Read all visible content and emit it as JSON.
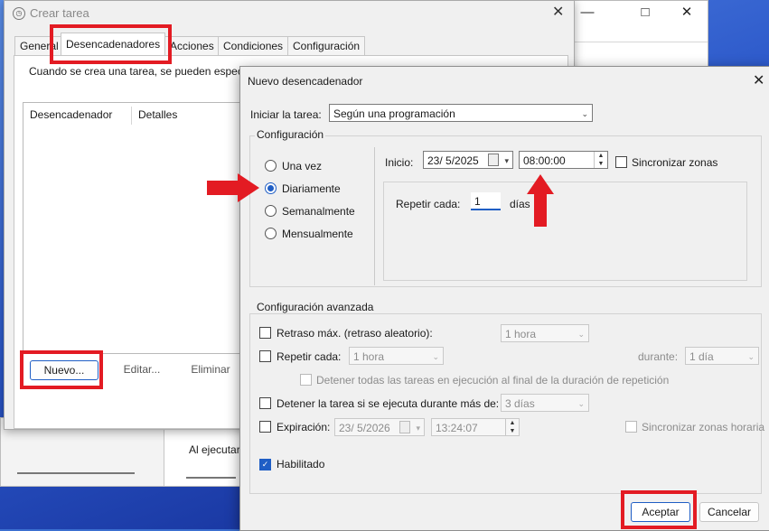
{
  "back_dialog": {
    "title": "Crear tarea",
    "tabs": [
      "General",
      "Desencadenadores",
      "Acciones",
      "Condiciones",
      "Configuración"
    ],
    "description": "Cuando se crea una tarea, se pueden especific",
    "columns": [
      "Desencadenador",
      "Detalles"
    ],
    "buttons": {
      "new": "Nuevo...",
      "edit": "Editar...",
      "delete": "Eliminar"
    },
    "lower_texts": [
      "Al ejecutar"
    ]
  },
  "dialog": {
    "title": "Nuevo desencadenador",
    "start_task_label": "Iniciar la tarea:",
    "start_task_value": "Según una programación",
    "config_group": "Configuración",
    "radios": [
      "Una vez",
      "Diariamente",
      "Semanalmente",
      "Mensualmente"
    ],
    "selected_radio": "Diariamente",
    "start_label": "Inicio:",
    "start_date": "23/  5/2025",
    "start_time": "08:00:00",
    "sync_zones": "Sincronizar zonas",
    "repeat_every_label": "Repetir cada:",
    "repeat_every_value": "1",
    "days_label": "días",
    "advanced_group": "Configuración avanzada",
    "delay_label": "Retraso máx. (retraso aleatorio):",
    "delay_value": "1 hora",
    "repeat_label": "Repetir cada:",
    "repeat_value": "1 hora",
    "duration_label": "durante:",
    "duration_value": "1 día",
    "stop_all_label": "Detener todas las tareas en ejecución al final de la duración de repetición",
    "stop_if_label": "Detener la tarea si se ejecuta durante más de:",
    "stop_if_value": "3 días",
    "expiration_label": "Expiración:",
    "expiration_date": "23/  5/2026",
    "expiration_time": "13:24:07",
    "sync_zones_utc": "Sincronizar zonas horaria",
    "enabled_label": "Habilitado",
    "enabled": true,
    "ok": "Aceptar",
    "cancel": "Cancelar"
  },
  "annotation_color": "#e31b23"
}
